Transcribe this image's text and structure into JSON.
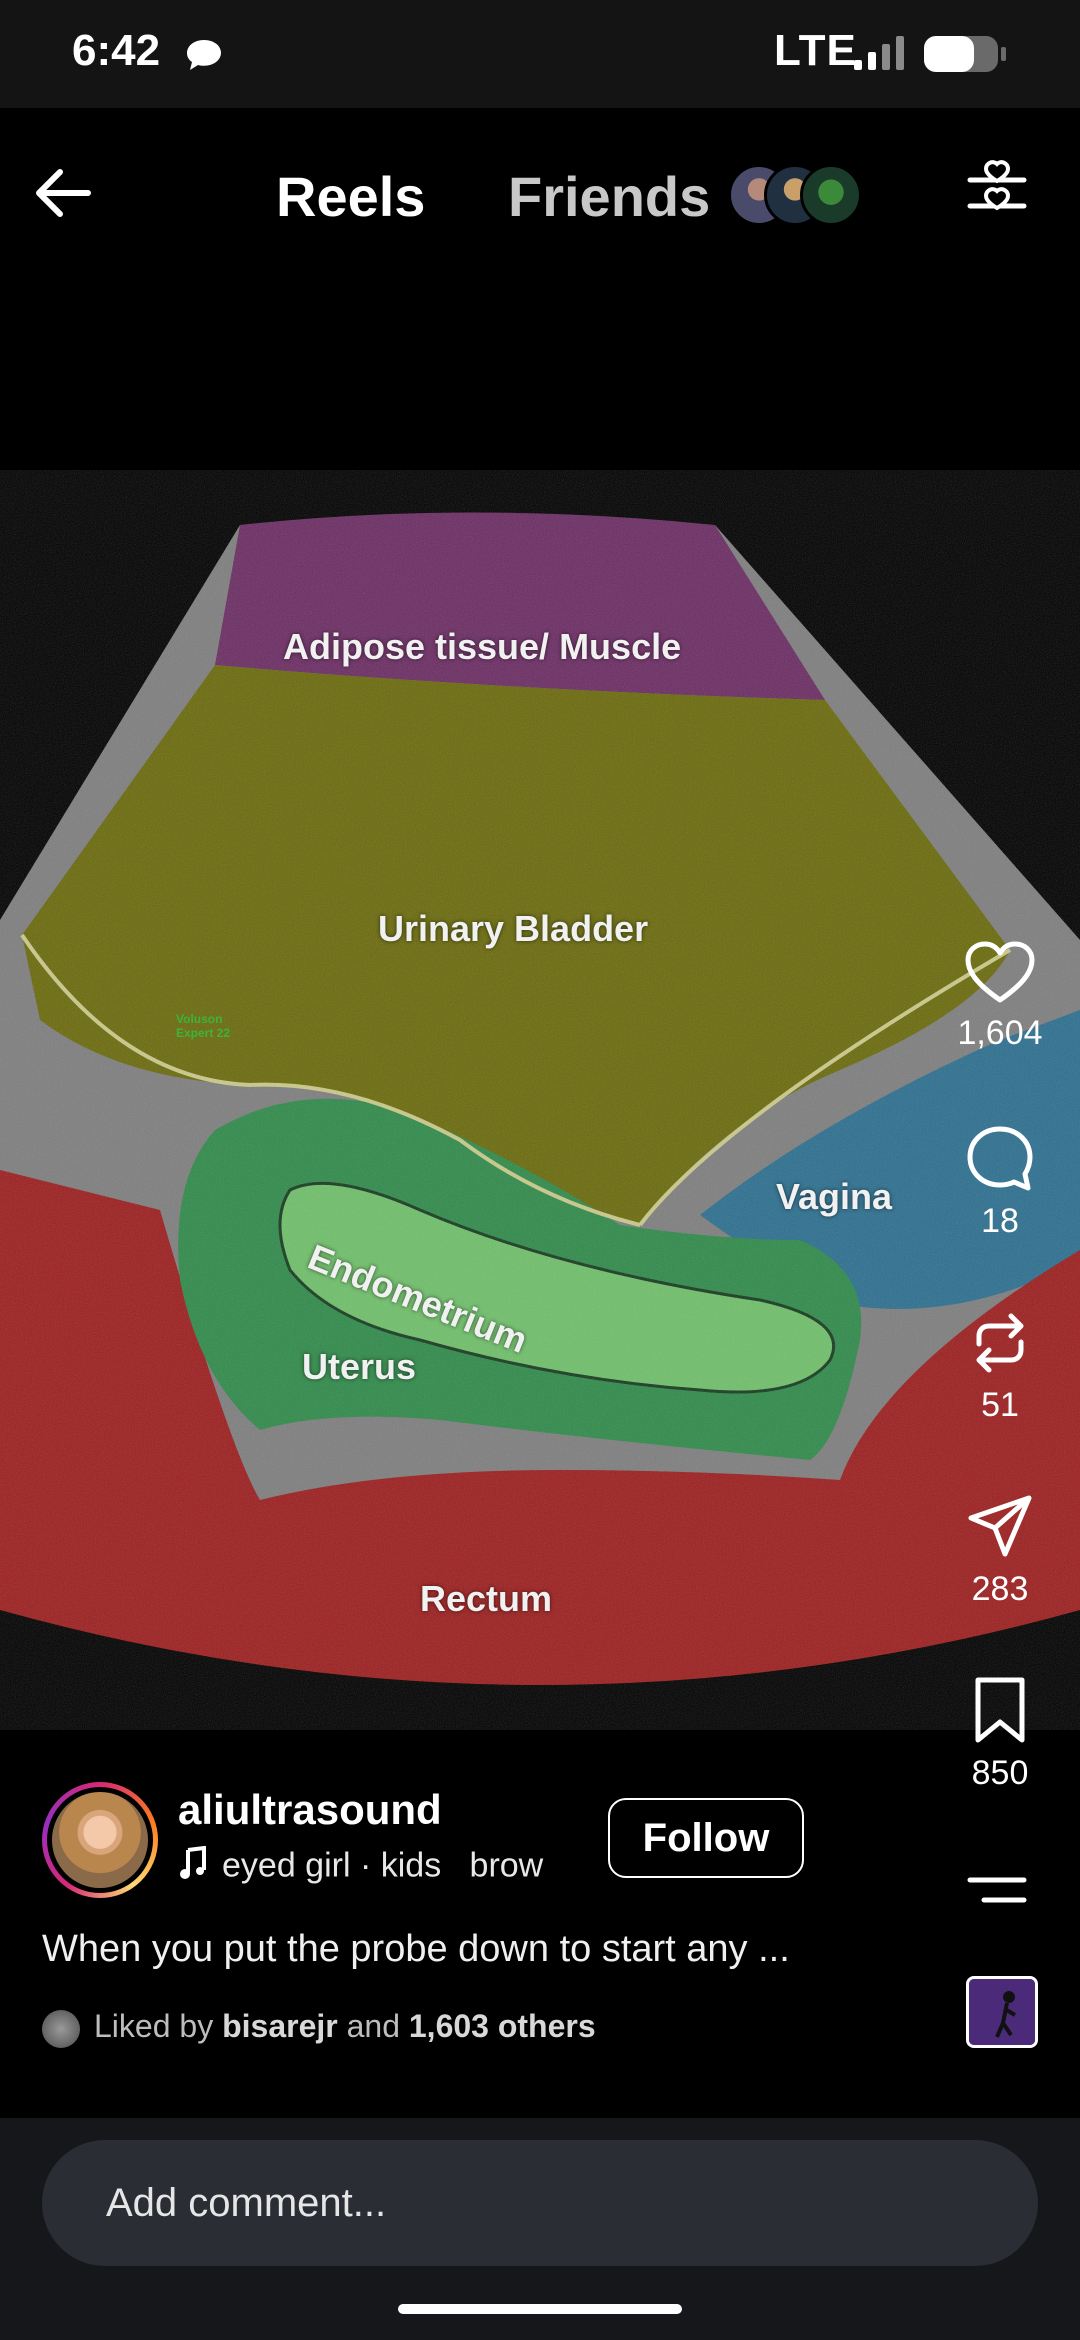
{
  "status_bar": {
    "time": "6:42",
    "network": "LTE"
  },
  "nav": {
    "tab_reels": "Reels",
    "tab_friends": "Friends"
  },
  "video": {
    "brand_line1": "Voluson",
    "brand_line2": "Expert 22",
    "labels": {
      "adipose": "Adipose tissue/ Muscle",
      "bladder": "Urinary Bladder",
      "vagina": "Vagina",
      "endometrium": "Endometrium",
      "uterus": "Uterus",
      "rectum": "Rectum"
    }
  },
  "actions": {
    "likes": "1,604",
    "comments": "18",
    "reposts": "51",
    "shares": "283",
    "saves": "850"
  },
  "post": {
    "username": "aliultrasound",
    "audio": "eyed girl · kids   brow",
    "follow_label": "Follow",
    "caption": "When you put the probe down to start any ...",
    "liked_prefix": "Liked by",
    "liked_user": "bisarejr",
    "liked_and": "and",
    "liked_others": "1,603 others"
  },
  "comment": {
    "placeholder": "Add comment..."
  },
  "colors": {
    "background": "#000000",
    "adipose_overlay": "#7a2f6e",
    "bladder_overlay": "#6b6a0a",
    "uterus_overlay": "#2f8a4a",
    "endometrium_overlay": "#6fbf6a",
    "vagina_overlay": "#2f7fa3",
    "rectum_overlay": "#a82020"
  }
}
